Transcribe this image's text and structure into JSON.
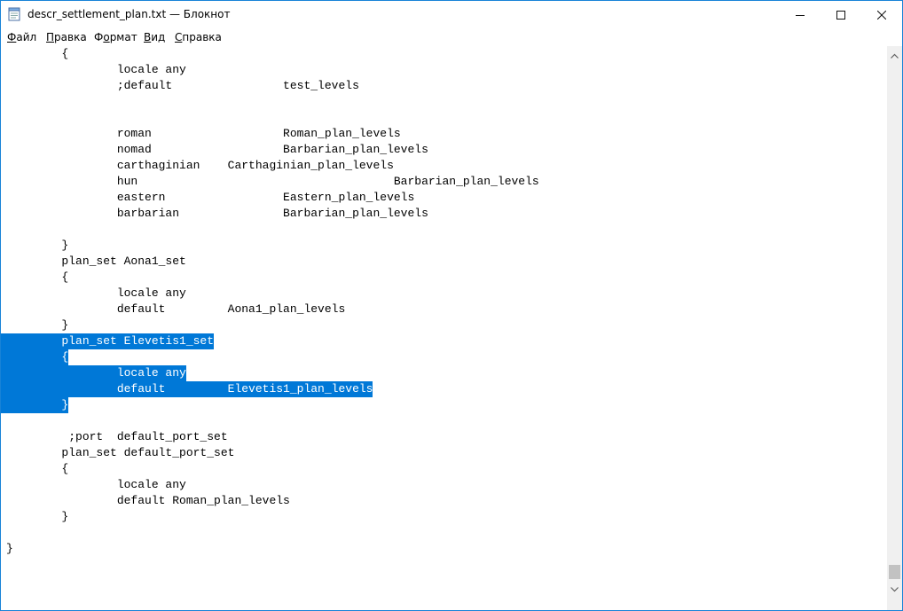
{
  "window": {
    "title": "descr_settlement_plan.txt — Блокнот"
  },
  "menu": [
    {
      "underline": "Ф",
      "rest": "айл"
    },
    {
      "underline": "П",
      "rest": "равка"
    },
    {
      "underline": "",
      "rest": "Ф",
      "mid_u": "о",
      "tail": "рмат"
    },
    {
      "underline": "В",
      "rest": "ид"
    },
    {
      "underline": "С",
      "rest": "правка"
    }
  ],
  "editor": {
    "lines": [
      "        {",
      "                locale any",
      "                ;default                test_levels",
      "",
      "",
      "                roman                   Roman_plan_levels",
      "                nomad                   Barbarian_plan_levels",
      "                carthaginian    Carthaginian_plan_levels",
      "                hun                                     Barbarian_plan_levels",
      "                eastern                 Eastern_plan_levels",
      "                barbarian               Barbarian_plan_levels",
      "",
      "        }",
      "        plan_set Aona1_set",
      "        {",
      "                locale any",
      "                default         Aona1_plan_levels",
      "        }",
      "        plan_set Elevetis1_set",
      "        {",
      "                locale any",
      "                default         Elevetis1_plan_levels",
      "        }",
      "",
      "         ;port  default_port_set",
      "        plan_set default_port_set",
      "        {",
      "                locale any",
      "                default Roman_plan_levels",
      "        }",
      "",
      "}"
    ],
    "selected_lines": [
      18,
      19,
      20,
      21,
      22
    ]
  },
  "icons": {
    "app": "notepad-icon",
    "minimize": "minimize-icon",
    "maximize": "maximize-icon",
    "close": "close-icon",
    "scroll_up": "chevron-up-icon",
    "scroll_down": "chevron-down-icon"
  },
  "colors": {
    "selection": "#0078d7",
    "border": "#1883d7"
  }
}
